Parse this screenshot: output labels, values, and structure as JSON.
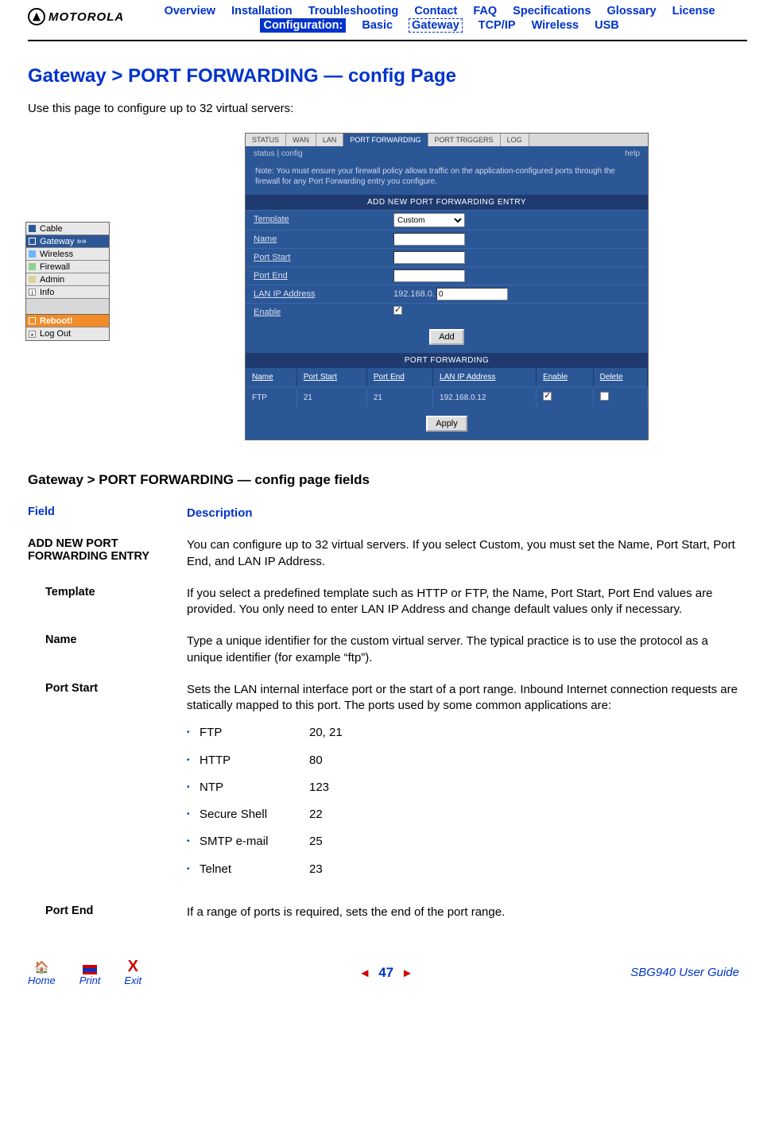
{
  "logo": {
    "text": "MOTOROLA"
  },
  "nav": {
    "row1": [
      "Overview",
      "Installation",
      "Troubleshooting",
      "Contact",
      "FAQ",
      "Specifications",
      "Glossary",
      "License"
    ],
    "conf_label": "Configuration:",
    "row2": [
      "Basic",
      "Gateway",
      "TCP/IP",
      "Wireless",
      "USB"
    ],
    "active_row2": "Gateway"
  },
  "title": "Gateway > PORT FORWARDING — config Page",
  "intro": "Use this page to configure up to 32 virtual servers:",
  "sidebar": {
    "items": [
      {
        "label": "Cable",
        "color": "#2b5797"
      },
      {
        "label": "Gateway   »»",
        "color": "#2b5797",
        "selected": true
      },
      {
        "label": "Wireless",
        "color": "#6fb6ff"
      },
      {
        "label": "Firewall",
        "color": "#8fd28f"
      },
      {
        "label": "Admin",
        "color": "#d8d49a"
      },
      {
        "label": "Info",
        "color": "#fff",
        "prefix": "i"
      }
    ],
    "reboot": "Reboot!",
    "logout": "Log Out"
  },
  "config_tabs": [
    "STATUS",
    "WAN",
    "LAN",
    "PORT FORWARDING",
    "PORT TRIGGERS",
    "LOG"
  ],
  "config_active_tab": "PORT FORWARDING",
  "subtab": {
    "left": "status | config",
    "right": "help"
  },
  "note": "Note: You must ensure your firewall policy allows traffic on the application-configured ports through the firewall for any Port Forwarding entry you configure.",
  "section1_title": "ADD NEW PORT FORWARDING ENTRY",
  "form": {
    "template_label": "Template",
    "template_value": "Custom",
    "name_label": "Name",
    "name_value": "",
    "portstart_label": "Port Start",
    "portstart_value": "",
    "portend_label": "Port End",
    "portend_value": "",
    "lanip_label": "LAN IP Address",
    "lanip_prefix": "192.168.0.",
    "lanip_value": "0",
    "enable_label": "Enable",
    "add_btn": "Add"
  },
  "section2_title": "PORT FORWARDING",
  "pf_headers": [
    "Name",
    "Port Start",
    "Port End",
    "LAN IP Address",
    "Enable",
    "Delete"
  ],
  "pf_row": {
    "name": "FTP",
    "pstart": "21",
    "pend": "21",
    "lan": "192.168.0.12",
    "enable": true,
    "delete": false
  },
  "apply_btn": "Apply",
  "section_heading": "Gateway > PORT FORWARDING — config page fields",
  "field_table": {
    "head_field": "Field",
    "head_desc": "Description",
    "rows": [
      {
        "field": "ADD NEW PORT FORWARDING ENTRY",
        "desc": "You can configure up to 32 virtual servers. If you select Custom, you must set the Name, Port Start, Port End, and LAN IP Address."
      },
      {
        "field": "Template",
        "indent": true,
        "desc": "If you select a predefined template such as HTTP or FTP, the Name, Port Start, Port End values are provided. You only need to enter LAN IP Address and change default values only if necessary."
      },
      {
        "field": "Name",
        "indent": true,
        "desc": "Type a unique identifier for the custom virtual server. The typical practice is to use the protocol as a unique identifier (for example “ftp”)."
      },
      {
        "field": "Port Start",
        "indent": true,
        "desc": "Sets the LAN internal interface port or the start of a port range. Inbound Internet connection requests are statically mapped to this port. The ports used by some common applications are:",
        "ports": [
          {
            "name": "FTP",
            "num": "20, 21"
          },
          {
            "name": "HTTP",
            "num": "80"
          },
          {
            "name": "NTP",
            "num": "123"
          },
          {
            "name": "Secure Shell",
            "num": "22"
          },
          {
            "name": "SMTP e-mail",
            "num": "25"
          },
          {
            "name": "Telnet",
            "num": "23"
          }
        ]
      },
      {
        "field": "Port End",
        "indent": true,
        "desc": "If a range of ports is required, sets the end of the port range."
      }
    ]
  },
  "footer": {
    "home": "Home",
    "print": "Print",
    "exit": "Exit",
    "exit_glyph": "X",
    "page": "47",
    "guide": "SBG940 User Guide"
  }
}
